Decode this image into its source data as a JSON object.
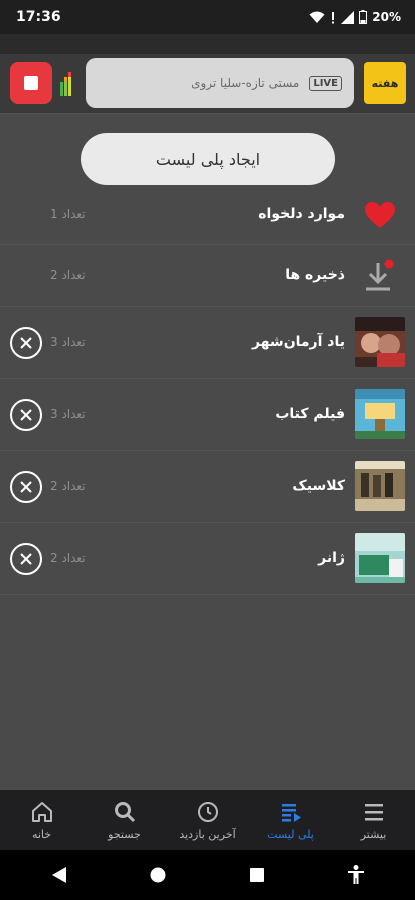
{
  "status_bar": {
    "time": "17:36",
    "battery": "20%"
  },
  "player": {
    "now_playing": "مستی تازه-سلیا تروی",
    "live_label": "LIVE",
    "station_logo_text": "هفته",
    "accent_color": "#e8383f",
    "logo_color": "#f3c318"
  },
  "create_playlist_label": "ایجاد پلی لیست",
  "playlists": [
    {
      "name": "موارد دلخواه",
      "count": "تعداد 1",
      "icon": "heart-icon",
      "removable": false
    },
    {
      "name": "ذخیره ها",
      "count": "تعداد 2",
      "icon": "download-icon",
      "removable": false
    },
    {
      "name": "یاد آرمان‌شهر",
      "count": "تعداد 3",
      "icon": "album-thumb",
      "removable": true
    },
    {
      "name": "فیلم کتاب",
      "count": "تعداد 3",
      "icon": "album-thumb",
      "removable": true
    },
    {
      "name": "کلاسیک",
      "count": "تعداد 2",
      "icon": "album-thumb",
      "removable": true
    },
    {
      "name": "ژانر",
      "count": "تعداد 2",
      "icon": "album-thumb",
      "removable": true
    }
  ],
  "bottom_nav": {
    "more": "بیشتر",
    "playlist": "پلی لیست",
    "recent": "آخرین بازدید",
    "search": "جستجو",
    "home": "خانه",
    "active_color": "#2f7ce0"
  }
}
